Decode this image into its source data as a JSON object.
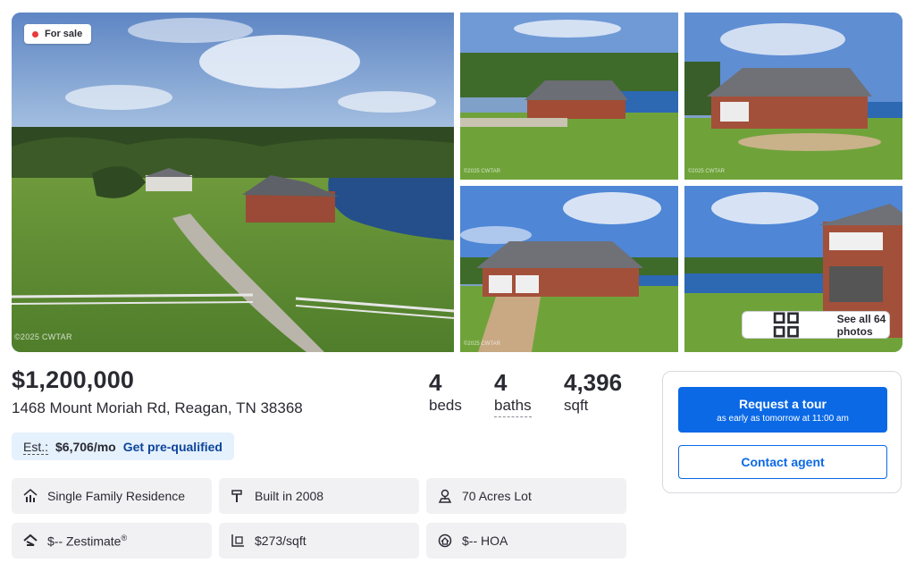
{
  "gallery": {
    "badge": "For sale",
    "watermark": "©2025 CWTAR",
    "see_all_label": "See all 64 photos"
  },
  "listing": {
    "price": "$1,200,000",
    "address": "1468 Mount Moriah Rd, Reagan, TN 38368",
    "beds": {
      "value": "4",
      "label": "beds"
    },
    "baths": {
      "value": "4",
      "label": "baths"
    },
    "sqft": {
      "value": "4,396",
      "label": "sqft"
    }
  },
  "estimate": {
    "label": "Est.:",
    "value": "$6,706/mo",
    "link": "Get pre-qualified"
  },
  "facts": [
    {
      "icon": "house-chart-icon",
      "text": "Single Family Residence"
    },
    {
      "icon": "hammer-icon",
      "text": "Built in 2008"
    },
    {
      "icon": "map-pin-icon",
      "text": "70 Acres Lot"
    },
    {
      "icon": "zestimate-icon",
      "text": "$-- Zestimate"
    },
    {
      "icon": "price-per-sqft-icon",
      "text": "$273/sqft"
    },
    {
      "icon": "hoa-icon",
      "text": "$-- HOA"
    }
  ],
  "contact": {
    "tour_label": "Request a tour",
    "tour_sub": "as early as tomorrow at 11:00 am",
    "agent_label": "Contact agent"
  },
  "colors": {
    "primary_blue": "#0b69e6",
    "link_blue": "#0d4599",
    "estimate_bg": "#e5f1fd",
    "fact_bg": "#f1f1f4",
    "sale_dot": "#e83a3a"
  }
}
